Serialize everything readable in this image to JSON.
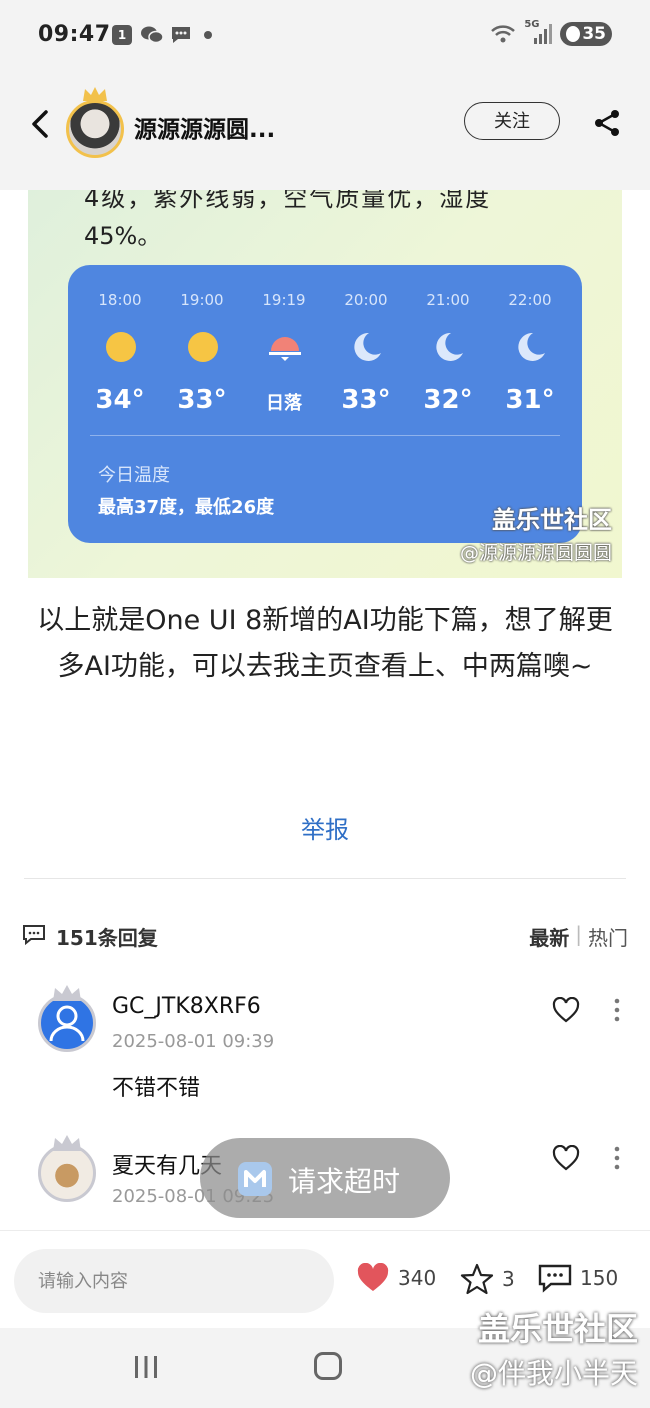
{
  "status_bar": {
    "time": "09:47",
    "notification_badge": "1",
    "network": "5G",
    "wifi_label": "5",
    "battery": "35"
  },
  "header": {
    "author": "源源源源圆...",
    "follow_label": "关注"
  },
  "image": {
    "line1": "4级，紫外线弱，空气质量优，湿度",
    "line2": "45%。",
    "forecast": [
      {
        "time": "18:00",
        "icon": "sun-icon",
        "temp": "34°"
      },
      {
        "time": "19:00",
        "icon": "sun-icon",
        "temp": "33°"
      },
      {
        "time": "19:19",
        "icon": "sunset-icon",
        "temp": "日落"
      },
      {
        "time": "20:00",
        "icon": "moon-icon",
        "temp": "33°"
      },
      {
        "time": "21:00",
        "icon": "moon-icon",
        "temp": "32°"
      },
      {
        "time": "22:00",
        "icon": "moon-icon",
        "temp": "31°"
      }
    ],
    "today_label": "今日温度",
    "range": "最高37度，最低26度",
    "watermark_site": "盖乐世社区",
    "watermark_user": "@源源源源圆圆圆"
  },
  "article": {
    "text": "以上就是One UI 8新增的AI功能下篇，想了解更多AI功能，可以去我主页查看上、中两篇噢~",
    "report_label": "举报"
  },
  "replies": {
    "count_label": "151条回复",
    "sort_latest": "最新",
    "sort_divider": "|",
    "sort_hot": "热门"
  },
  "comments": [
    {
      "name": "GC_JTK8XRF6",
      "time": "2025-08-01 09:39",
      "body": "不错不错"
    },
    {
      "name": "夏天有几天",
      "time": "2025-08-01 09:25",
      "body": ""
    }
  ],
  "toast": {
    "text": "请求超时"
  },
  "bottom": {
    "input_placeholder": "请输入内容",
    "likes": "340",
    "favorites": "3",
    "comments": "150"
  },
  "watermark": {
    "site": "盖乐世社区",
    "user": "@伴我小半天"
  },
  "colors": {
    "accent_blue": "#2f6fc6",
    "card_blue": "#4f86e0",
    "like_red": "#e2555c"
  }
}
